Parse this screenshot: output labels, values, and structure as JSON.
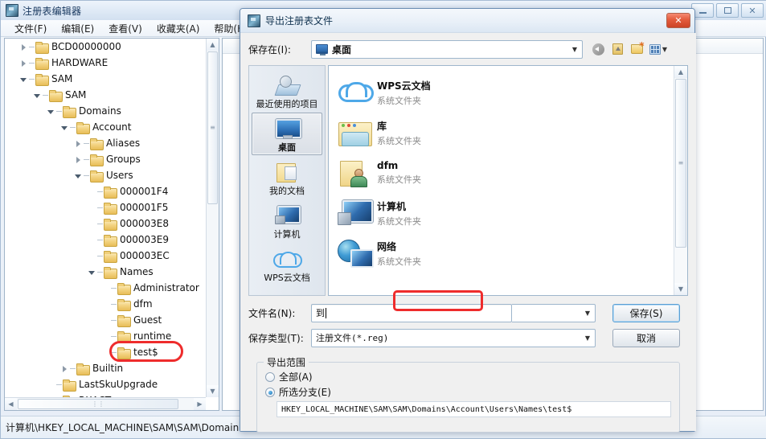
{
  "regedit": {
    "title": "注册表编辑器",
    "title_icon": "registry-icon",
    "menus": [
      "文件(F)",
      "编辑(E)",
      "查看(V)",
      "收藏夹(A)",
      "帮助(H)"
    ],
    "window_controls": {
      "minimize": "minimize-icon",
      "maximize": "maximize-icon",
      "close": "close-icon"
    },
    "tree": [
      {
        "label": "BCD00000000",
        "depth": 1,
        "state": "collapsed"
      },
      {
        "label": "HARDWARE",
        "depth": 1,
        "state": "collapsed"
      },
      {
        "label": "SAM",
        "depth": 1,
        "state": "expanded"
      },
      {
        "label": "SAM",
        "depth": 2,
        "state": "expanded"
      },
      {
        "label": "Domains",
        "depth": 3,
        "state": "expanded"
      },
      {
        "label": "Account",
        "depth": 4,
        "state": "expanded"
      },
      {
        "label": "Aliases",
        "depth": 5,
        "state": "collapsed"
      },
      {
        "label": "Groups",
        "depth": 5,
        "state": "collapsed"
      },
      {
        "label": "Users",
        "depth": 5,
        "state": "expanded"
      },
      {
        "label": "000001F4",
        "depth": 6,
        "state": "leaf"
      },
      {
        "label": "000001F5",
        "depth": 6,
        "state": "leaf"
      },
      {
        "label": "000003E8",
        "depth": 6,
        "state": "leaf"
      },
      {
        "label": "000003E9",
        "depth": 6,
        "state": "leaf"
      },
      {
        "label": "000003EC",
        "depth": 6,
        "state": "leaf"
      },
      {
        "label": "Names",
        "depth": 6,
        "state": "expanded"
      },
      {
        "label": "Administrator",
        "depth": 7,
        "state": "leaf"
      },
      {
        "label": "dfm",
        "depth": 7,
        "state": "leaf"
      },
      {
        "label": "Guest",
        "depth": 7,
        "state": "leaf"
      },
      {
        "label": "runtime",
        "depth": 7,
        "state": "leaf"
      },
      {
        "label": "test$",
        "depth": 7,
        "state": "leaf",
        "highlighted": true
      },
      {
        "label": "Builtin",
        "depth": 4,
        "state": "collapsed"
      },
      {
        "label": "LastSkuUpgrade",
        "depth": 3,
        "state": "leaf"
      },
      {
        "label": "RXACT",
        "depth": 3,
        "state": "leaf"
      }
    ],
    "status_bar": "计算机\\HKEY_LOCAL_MACHINE\\SAM\\SAM\\Domain"
  },
  "dialog": {
    "title": "导出注册表文件",
    "title_icon": "registry-icon",
    "close_label": "✕",
    "save_in": {
      "label": "保存在(I):",
      "value": "桌面",
      "value_icon": "monitor-icon",
      "dropdown_icon": "chevron-down-icon"
    },
    "toolbar": {
      "back": "back-icon",
      "up": "up-folder-icon",
      "new_folder": "new-folder-icon",
      "views": "views-icon",
      "views_caret": "chevron-down-icon"
    },
    "places": [
      {
        "label": "最近使用的项目",
        "icon": "recent-items-icon",
        "selected": false
      },
      {
        "label": "桌面",
        "icon": "desktop-icon",
        "selected": true
      },
      {
        "label": "我的文档",
        "icon": "my-documents-icon",
        "selected": false
      },
      {
        "label": "计算机",
        "icon": "computer-icon",
        "selected": false
      },
      {
        "label": "WPS云文档",
        "icon": "cloud-icon",
        "selected": false
      }
    ],
    "files": [
      {
        "name": "WPS云文档",
        "type": "系统文件夹",
        "icon": "cloud-icon"
      },
      {
        "name": "库",
        "type": "系统文件夹",
        "icon": "library-icon"
      },
      {
        "name": "dfm",
        "type": "系统文件夹",
        "icon": "user-folder-icon"
      },
      {
        "name": "计算机",
        "type": "系统文件夹",
        "icon": "computer-icon"
      },
      {
        "name": "网络",
        "type": "系统文件夹",
        "icon": "network-icon"
      }
    ],
    "file_name": {
      "label": "文件名(N):",
      "value": "到",
      "dropdown_icon": "chevron-down-icon"
    },
    "save_type": {
      "label": "保存类型(T):",
      "value": "注册文件(*.reg)",
      "dropdown_icon": "chevron-down-icon"
    },
    "buttons": {
      "save": "保存(S)",
      "cancel": "取消"
    },
    "export_range": {
      "title": "导出范围",
      "options": [
        {
          "label": "全部(A)",
          "checked": false
        },
        {
          "label": "所选分支(E)",
          "checked": true
        }
      ],
      "branch_path": "HKEY_LOCAL_MACHINE\\SAM\\SAM\\Domains\\Account\\Users\\Names\\test$"
    }
  },
  "annotations": {
    "tree_highlight": "red-rectangle-around-test-key",
    "filename_highlight": "red-rectangle-around-filename-input"
  },
  "colors": {
    "annotation": "#ee2c2c",
    "accent": "#2f6cae",
    "dialog_bg": "#f0f0f0"
  }
}
